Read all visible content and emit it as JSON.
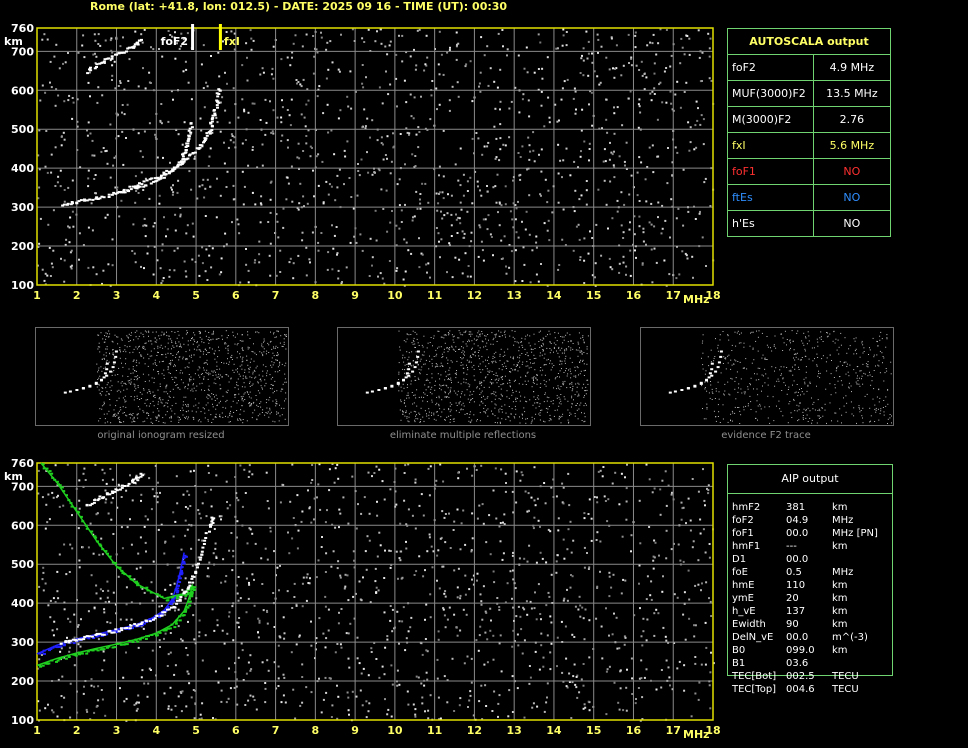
{
  "header": "Rome (lat: +41.8, lon: 012.5) - DATE: 2025 09 16 - TIME (UT): 00:30",
  "axes": {
    "x_ticks": [
      "1",
      "2",
      "3",
      "4",
      "5",
      "6",
      "7",
      "8",
      "9",
      "10",
      "11",
      "12",
      "13",
      "14",
      "15",
      "16",
      "17",
      "18"
    ],
    "x_unit": "MHz",
    "y_ticks": [
      "100",
      "200",
      "300",
      "400",
      "500",
      "600",
      "700",
      "760"
    ],
    "y_unit": "km"
  },
  "markers": {
    "fof2_label": "foF2",
    "fxi_label": "fxI"
  },
  "autoscala": {
    "title": "AUTOSCALA output",
    "rows": [
      {
        "label": "foF2",
        "value": "4.9 MHz",
        "color": "#ffffff"
      },
      {
        "label": "MUF(3000)F2",
        "value": "13.5 MHz",
        "color": "#ffffff"
      },
      {
        "label": "M(3000)F2",
        "value": "2.76",
        "color": "#ffffff"
      },
      {
        "label": "fxI",
        "value": "5.6 MHz",
        "color": "#ffff66"
      },
      {
        "label": "foF1",
        "value": "NO",
        "color": "#ff3030"
      },
      {
        "label": "ftEs",
        "value": "NO",
        "color": "#2f8fff"
      },
      {
        "label": "h'Es",
        "value": "NO",
        "color": "#ffffff"
      }
    ]
  },
  "thumbnails": [
    {
      "caption": "original ionogram resized"
    },
    {
      "caption": "eliminate multiple reflections"
    },
    {
      "caption": "evidence F2 trace"
    }
  ],
  "aip": {
    "title": "AIP output",
    "rows": [
      {
        "name": "hmF2",
        "value": "381",
        "unit": "km"
      },
      {
        "name": "foF2",
        "value": "04.9",
        "unit": "MHz"
      },
      {
        "name": "foF1",
        "value": "00.0",
        "unit": "MHz   [PN]"
      },
      {
        "name": "hmF1",
        "value": "---",
        "unit": "km"
      },
      {
        "name": "D1",
        "value": "00.0",
        "unit": ""
      },
      {
        "name": "foE",
        "value": "0.5",
        "unit": "MHz"
      },
      {
        "name": "hmE",
        "value": "110",
        "unit": "km"
      },
      {
        "name": "ymE",
        "value": "20",
        "unit": "km"
      },
      {
        "name": "h_vE",
        "value": "137",
        "unit": "km"
      },
      {
        "name": "Ewidth",
        "value": "90",
        "unit": "km"
      },
      {
        "name": "DelN_vE",
        "value": "00.0",
        "unit": "m^(-3)"
      },
      {
        "name": "B0",
        "value": "099.0",
        "unit": "km"
      },
      {
        "name": "B1",
        "value": "03.6",
        "unit": ""
      },
      {
        "name": "TEC[Bot]",
        "value": "002.5",
        "unit": "TECU"
      },
      {
        "name": "TEC[Top]",
        "value": "004.6",
        "unit": "TECU"
      }
    ]
  },
  "chart_data": [
    {
      "type": "scatter",
      "title": "",
      "xlabel": "MHz",
      "ylabel": "km",
      "xlim": [
        1,
        18
      ],
      "ylim": [
        100,
        760
      ],
      "grid": true,
      "series": [
        {
          "color": "#ffffff",
          "points": [
            [
              1.6,
              308
            ],
            [
              2.0,
              316
            ],
            [
              2.5,
              327
            ],
            [
              3.0,
              338
            ],
            [
              3.5,
              352
            ],
            [
              4.0,
              372
            ],
            [
              4.4,
              398
            ],
            [
              4.6,
              420
            ],
            [
              4.7,
              450
            ],
            [
              4.8,
              480
            ],
            [
              4.85,
              520
            ]
          ]
        },
        {
          "color": "#ffffff",
          "points": [
            [
              3.0,
              342
            ],
            [
              3.5,
              358
            ],
            [
              4.0,
              380
            ],
            [
              4.4,
              402
            ],
            [
              4.8,
              432
            ],
            [
              5.1,
              462
            ],
            [
              5.3,
              495
            ],
            [
              5.4,
              530
            ],
            [
              5.5,
              570
            ],
            [
              5.55,
              610
            ]
          ]
        },
        {
          "color": "#ffffff",
          "points": [
            [
              2.2,
              650
            ],
            [
              2.6,
              675
            ],
            [
              3.0,
              695
            ],
            [
              3.4,
              715
            ],
            [
              3.6,
              735
            ]
          ]
        }
      ]
    },
    {
      "type": "line",
      "title": "",
      "xlabel": "MHz",
      "ylabel": "km",
      "xlim": [
        1,
        18
      ],
      "ylim": [
        100,
        760
      ],
      "grid": true,
      "series": [
        {
          "color": "#2020ff",
          "points": [
            [
              1.0,
              270
            ],
            [
              1.5,
              292
            ],
            [
              2.0,
              308
            ],
            [
              2.5,
              320
            ],
            [
              3.0,
              332
            ],
            [
              3.5,
              345
            ],
            [
              3.9,
              362
            ],
            [
              4.2,
              382
            ],
            [
              4.4,
              410
            ],
            [
              4.5,
              440
            ],
            [
              4.6,
              480
            ],
            [
              4.7,
              530
            ]
          ]
        },
        {
          "color": "#20d020",
          "points": [
            [
              1.0,
              240
            ],
            [
              1.5,
              258
            ],
            [
              2.0,
              272
            ],
            [
              2.5,
              284
            ],
            [
              3.0,
              295
            ],
            [
              3.5,
              307
            ],
            [
              4.0,
              323
            ],
            [
              4.4,
              345
            ],
            [
              4.7,
              380
            ],
            [
              4.85,
              420
            ],
            [
              4.9,
              445
            ],
            [
              4.7,
              425
            ],
            [
              4.2,
              412
            ],
            [
              3.5,
              450
            ],
            [
              3.0,
              495
            ],
            [
              2.5,
              560
            ],
            [
              2.0,
              635
            ],
            [
              1.5,
              710
            ],
            [
              1.1,
              760
            ]
          ]
        },
        {
          "color": "#ffffff",
          "points": [
            [
              1.6,
              300
            ],
            [
              2.0,
              310
            ],
            [
              2.5,
              320
            ],
            [
              3.0,
              333
            ],
            [
              3.5,
              348
            ],
            [
              4.0,
              368
            ],
            [
              4.4,
              392
            ],
            [
              4.7,
              430
            ],
            [
              4.9,
              470
            ],
            [
              5.1,
              530
            ],
            [
              5.3,
              600
            ],
            [
              5.4,
              620
            ]
          ]
        },
        {
          "color": "#ffffff",
          "points": [
            [
              2.2,
              650
            ],
            [
              2.6,
              675
            ],
            [
              3.0,
              695
            ],
            [
              3.4,
              715
            ],
            [
              3.6,
              735
            ]
          ]
        }
      ]
    }
  ]
}
